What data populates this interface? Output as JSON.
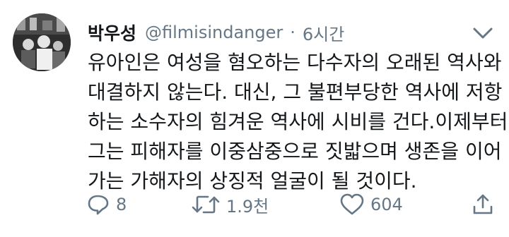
{
  "tweet": {
    "display_name": "박우성",
    "handle": "@filmisindanger",
    "separator": "·",
    "time": "6시간",
    "text_lines": [
      "유아인은 여성을 혐오하는 다수자의 오래된 역사와",
      "대결하지 않는다. 대신, 그 불편부당한 역사에 저항",
      "하는 소수자의 힘겨운 역사에 시비를 건다.이제부터",
      "그는 피해자를 이중삼중으로 짓밟으며 생존을 이어",
      "가는 가해자의 상징적 얼굴이 될 것이다."
    ]
  },
  "actions": {
    "reply_count": "8",
    "retweet_count": "1.9천",
    "like_count": "604"
  },
  "icons": {
    "reply": "speech-bubble-icon",
    "retweet": "retweet-arrows-icon",
    "like": "heart-icon",
    "share": "share-upload-icon",
    "menu": "chevron-down-icon"
  },
  "colors": {
    "text": "#14171a",
    "muted": "#657786",
    "background": "#ffffff"
  }
}
